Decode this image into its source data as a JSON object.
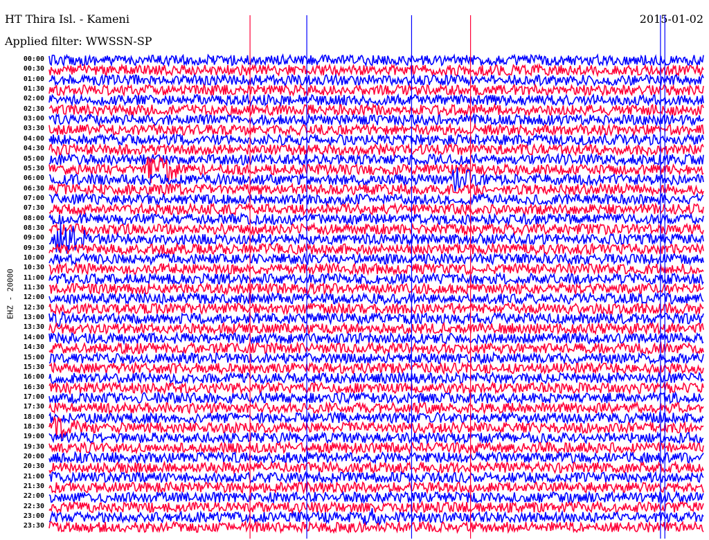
{
  "header": {
    "title": "HT Thira Isl. - Kameni",
    "filter": "Applied filter: WWSSN-SP",
    "date": "2015-01-02"
  },
  "chart_data": {
    "type": "line",
    "title": "HT Thira Isl. - Kameni",
    "subtitle": "Applied filter: WWSSN-SP",
    "ylabel": "EHZ - 20000",
    "xlabel": "",
    "minutes_per_row": 30,
    "colors": [
      "#0000ff",
      "#ff0038"
    ],
    "rows": [
      "00:00",
      "00:30",
      "01:00",
      "01:30",
      "02:00",
      "02:30",
      "03:00",
      "03:30",
      "04:00",
      "04:30",
      "05:00",
      "05:30",
      "06:00",
      "06:30",
      "07:00",
      "07:30",
      "08:00",
      "08:30",
      "09:00",
      "09:30",
      "10:00",
      "10:30",
      "11:00",
      "11:30",
      "12:00",
      "12:30",
      "13:00",
      "13:30",
      "14:00",
      "14:30",
      "15:00",
      "15:30",
      "16:00",
      "16:30",
      "17:00",
      "17:30",
      "18:00",
      "18:30",
      "19:00",
      "19:30",
      "20:00",
      "20:30",
      "21:00",
      "21:30",
      "22:00",
      "22:30",
      "23:00",
      "23:30"
    ],
    "events": [
      {
        "row": 11,
        "minute": 4.5,
        "duration": 1.5,
        "amplitude": 3.5
      },
      {
        "row": 12,
        "minute": 18.5,
        "duration": 1.5,
        "amplitude": 2.5
      },
      {
        "row": 18,
        "minute": 0.3,
        "duration": 1.5,
        "amplitude": 3.5
      },
      {
        "row": 37,
        "minute": 0.2,
        "duration": 1.5,
        "amplitude": 2.5
      },
      {
        "row": 46,
        "minute": 14.4,
        "duration": 0.8,
        "amplitude": 2.5
      },
      {
        "row": 26,
        "minute": 0.2,
        "duration": 0.6,
        "amplitude": 2
      }
    ],
    "spikes_full_height": [
      {
        "minute": 9.2,
        "color": "#ff0038"
      },
      {
        "minute": 19.3,
        "color": "#ff0038"
      },
      {
        "minute": 16.6,
        "color": "#0000ff"
      },
      {
        "minute": 11.8,
        "color": "#0000ff"
      },
      {
        "minute": 28.0,
        "color": "#0000ff"
      },
      {
        "minute": 28.2,
        "color": "#0000ff"
      }
    ]
  }
}
